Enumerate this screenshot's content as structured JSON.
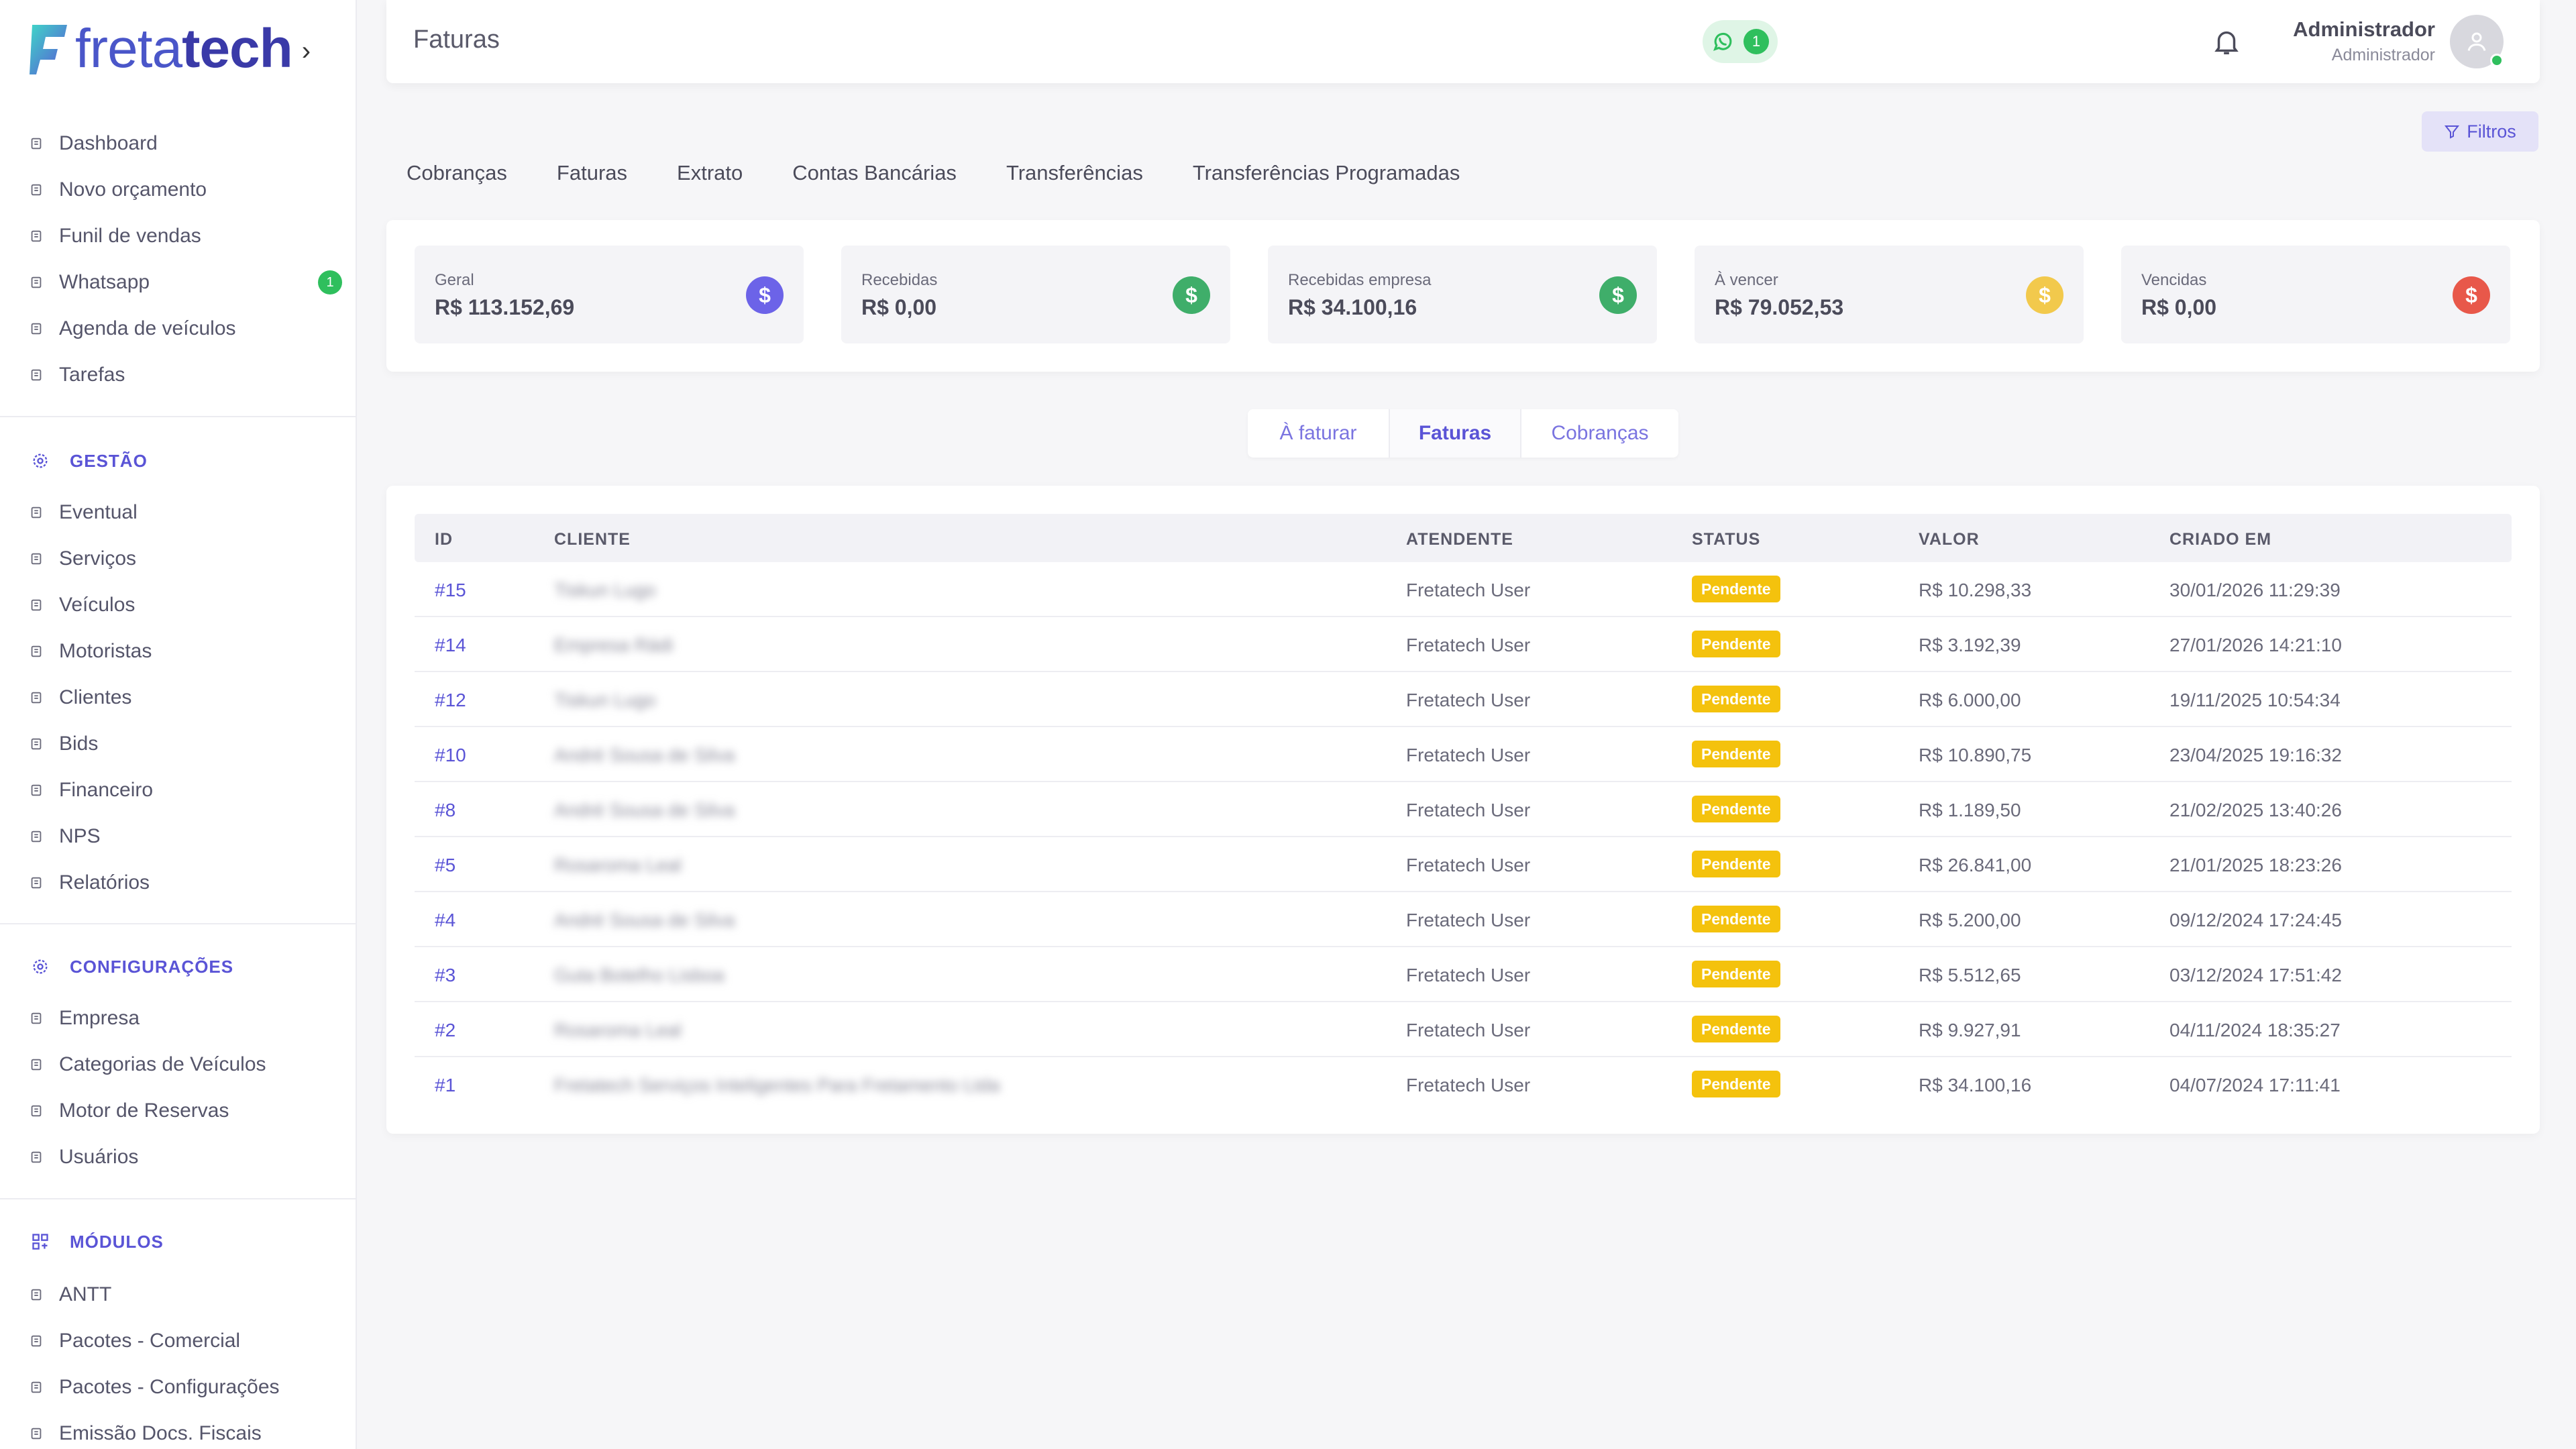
{
  "brand": {
    "logo_light": "freta",
    "logo_bold": "tech",
    "colors": {
      "primary": "#5a54d6",
      "whatsapp": "#2fbf5d"
    }
  },
  "sidebar": {
    "items": [
      {
        "label": "Dashboard",
        "icon": "home-icon"
      },
      {
        "label": "Novo orçamento",
        "icon": "edit-icon"
      },
      {
        "label": "Funil de vendas",
        "icon": "funnel-icon"
      },
      {
        "label": "Whatsapp",
        "icon": "whatsapp-icon",
        "badge": "1"
      },
      {
        "label": "Agenda de veículos",
        "icon": "calendar-icon"
      },
      {
        "label": "Tarefas",
        "icon": "list-icon"
      }
    ],
    "gestao": {
      "title": "GESTÃO",
      "items": [
        {
          "label": "Eventual",
          "icon": "document-icon"
        },
        {
          "label": "Serviços",
          "icon": "clipboard-icon"
        },
        {
          "label": "Veículos",
          "icon": "bus-icon"
        },
        {
          "label": "Motoristas",
          "icon": "steering-wheel-icon"
        },
        {
          "label": "Clientes",
          "icon": "users-icon"
        },
        {
          "label": "Bids",
          "icon": "gavel-icon"
        },
        {
          "label": "Financeiro",
          "icon": "coin-icon"
        },
        {
          "label": "NPS",
          "icon": "chat-icon"
        },
        {
          "label": "Relatórios",
          "icon": "report-icon"
        }
      ]
    },
    "config": {
      "title": "CONFIGURAÇÕES",
      "items": [
        {
          "label": "Empresa",
          "icon": "building-icon"
        },
        {
          "label": "Categorias de Veículos",
          "icon": "grid-icon"
        },
        {
          "label": "Motor de Reservas",
          "icon": "table-icon"
        },
        {
          "label": "Usuários",
          "icon": "user-icon"
        }
      ]
    },
    "modulos": {
      "title": "MÓDULOS",
      "items": [
        {
          "label": "ANTT",
          "icon": "triangle-icon"
        },
        {
          "label": "Pacotes - Comercial",
          "icon": "package-icon"
        },
        {
          "label": "Pacotes - Configurações",
          "icon": "package-settings-icon"
        },
        {
          "label": "Emissão Docs. Fiscais",
          "icon": "receipt-icon"
        }
      ]
    }
  },
  "header": {
    "title": "Faturas",
    "whatsapp_count": "1",
    "user_name": "Administrador",
    "user_role": "Administrador"
  },
  "filters_label": "Filtros",
  "tabs": [
    "Cobranças",
    "Faturas",
    "Extrato",
    "Contas Bancárias",
    "Transferências",
    "Transferências Programadas"
  ],
  "summary": [
    {
      "label": "Geral",
      "value": "R$ 113.152,69",
      "color": "#6c63e8"
    },
    {
      "label": "Recebidas",
      "value": "R$ 0,00",
      "color": "#3fae6a"
    },
    {
      "label": "Recebidas empresa",
      "value": "R$ 34.100,16",
      "color": "#3fae6a"
    },
    {
      "label": "À vencer",
      "value": "R$ 79.052,53",
      "color": "#f2c94c"
    },
    {
      "label": "Vencidas",
      "value": "R$ 0,00",
      "color": "#e8584a"
    }
  ],
  "segment": [
    "À faturar",
    "Faturas",
    "Cobranças"
  ],
  "table": {
    "headers": [
      "ID",
      "CLIENTE",
      "ATENDENTE",
      "STATUS",
      "VALOR",
      "CRIADO EM"
    ],
    "rows": [
      {
        "id": "#15",
        "cliente": "Tiskun Lugo",
        "atendente": "Fretatech User",
        "status": "Pendente",
        "valor": "R$ 10.298,33",
        "criado": "30/01/2026 11:29:39"
      },
      {
        "id": "#14",
        "cliente": "Empresa Rádi",
        "atendente": "Fretatech User",
        "status": "Pendente",
        "valor": "R$ 3.192,39",
        "criado": "27/01/2026 14:21:10"
      },
      {
        "id": "#12",
        "cliente": "Tiskun Lugo",
        "atendente": "Fretatech User",
        "status": "Pendente",
        "valor": "R$ 6.000,00",
        "criado": "19/11/2025 10:54:34"
      },
      {
        "id": "#10",
        "cliente": "André Sousa de Silva",
        "atendente": "Fretatech User",
        "status": "Pendente",
        "valor": "R$ 10.890,75",
        "criado": "23/04/2025 19:16:32"
      },
      {
        "id": "#8",
        "cliente": "André Sousa de Silva",
        "atendente": "Fretatech User",
        "status": "Pendente",
        "valor": "R$ 1.189,50",
        "criado": "21/02/2025 13:40:26"
      },
      {
        "id": "#5",
        "cliente": "Rosaroma Leal",
        "atendente": "Fretatech User",
        "status": "Pendente",
        "valor": "R$ 26.841,00",
        "criado": "21/01/2025 18:23:26"
      },
      {
        "id": "#4",
        "cliente": "André Sousa de Silva",
        "atendente": "Fretatech User",
        "status": "Pendente",
        "valor": "R$ 5.200,00",
        "criado": "09/12/2024 17:24:45"
      },
      {
        "id": "#3",
        "cliente": "Guta Botelho Lisboa",
        "atendente": "Fretatech User",
        "status": "Pendente",
        "valor": "R$ 5.512,65",
        "criado": "03/12/2024 17:51:42"
      },
      {
        "id": "#2",
        "cliente": "Rosaroma Leal",
        "atendente": "Fretatech User",
        "status": "Pendente",
        "valor": "R$ 9.927,91",
        "criado": "04/11/2024 18:35:27"
      },
      {
        "id": "#1",
        "cliente": "Fretatech Serviços Inteligentes Para Fretamento Ltda",
        "atendente": "Fretatech User",
        "status": "Pendente",
        "valor": "R$ 34.100,16",
        "criado": "04/07/2024 17:11:41"
      }
    ]
  }
}
